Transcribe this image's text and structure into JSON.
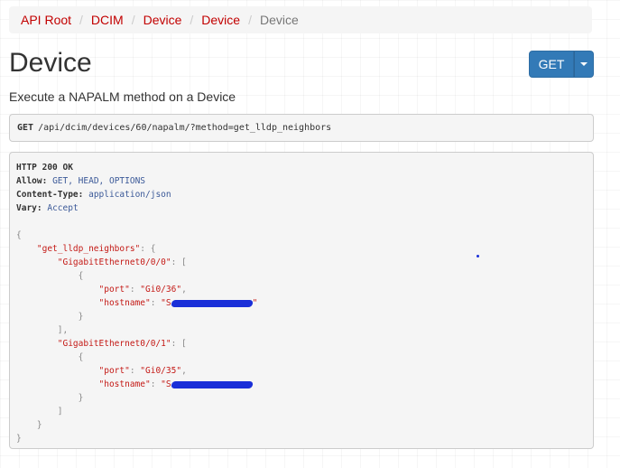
{
  "breadcrumb": [
    "API Root",
    "DCIM",
    "Device",
    "Device",
    "Device"
  ],
  "title": "Device",
  "description": "Execute a NAPALM method on a Device",
  "button": {
    "label": "GET"
  },
  "request": {
    "method": "GET",
    "path": "/api/dcim/devices/60/napalm/?method=get_lldp_neighbors"
  },
  "response": {
    "status_line": "HTTP 200 OK",
    "headers": [
      {
        "name": "Allow:",
        "value": "GET, HEAD, OPTIONS"
      },
      {
        "name": "Content-Type:",
        "value": "application/json"
      },
      {
        "name": "Vary:",
        "value": "Accept"
      }
    ],
    "key_root": "\"get_lldp_neighbors\"",
    "iface1": "\"GigabitEthernet0/0/0\"",
    "iface2": "\"GigabitEthernet0/0/1\"",
    "port1": "\"Gi0/36\"",
    "port2": "\"Gi0/35\"",
    "port_key": "\"port\"",
    "hostname_key": "\"hostname\""
  },
  "colors": {
    "accent": "#337ab7",
    "link": "#c20000",
    "redaction": "#1a2fd8"
  }
}
